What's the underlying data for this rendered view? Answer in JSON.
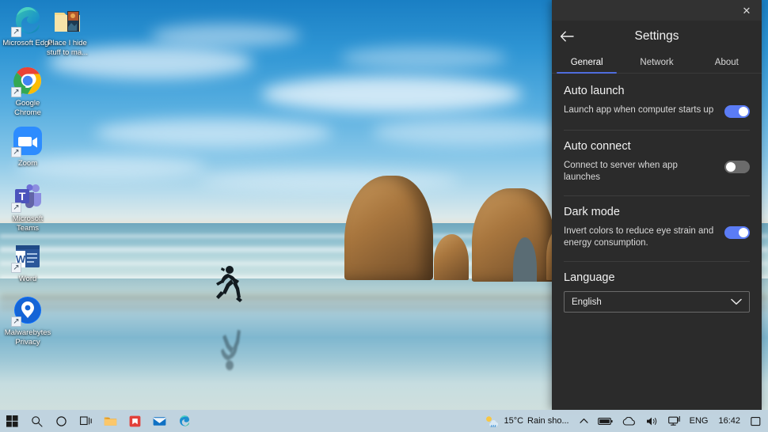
{
  "desktop": {
    "icons": [
      {
        "name": "microsoft-edge",
        "label": "Microsoft Edge",
        "shortcut": true
      },
      {
        "name": "folder-place-i-hide",
        "label": "Place I hide stuff to ma...",
        "shortcut": false
      },
      {
        "name": "google-chrome",
        "label": "Google Chrome",
        "shortcut": true
      },
      {
        "name": "zoom",
        "label": "Zoom",
        "shortcut": true
      },
      {
        "name": "microsoft-teams",
        "label": "Microsoft Teams",
        "shortcut": true
      },
      {
        "name": "word",
        "label": "Word",
        "shortcut": true
      },
      {
        "name": "malwarebytes-privacy",
        "label": "Malwarebytes Privacy",
        "shortcut": true
      }
    ]
  },
  "taskbar": {
    "buttons": [
      {
        "name": "start-button",
        "icon": "windows-logo-icon"
      },
      {
        "name": "search-button",
        "icon": "search-icon"
      },
      {
        "name": "cortana-button",
        "icon": "cortana-circle-icon"
      },
      {
        "name": "task-view-button",
        "icon": "task-view-icon"
      },
      {
        "name": "file-explorer-button",
        "icon": "folder-icon"
      },
      {
        "name": "app-red-button",
        "icon": "red-app-icon"
      },
      {
        "name": "mail-button",
        "icon": "mail-icon"
      },
      {
        "name": "edge-taskbar-button",
        "icon": "edge-icon"
      }
    ],
    "tray": {
      "weather_temp": "15°C",
      "weather_desc": "Rain sho...",
      "weather_icon": "sun-cloud-rain-icon",
      "overflow_icon": "chevron-up-icon",
      "battery_icon": "battery-icon",
      "onedrive_icon": "cloud-icon",
      "volume_icon": "speaker-icon",
      "network_icon": "network-monitor-icon",
      "language": "ENG",
      "clock": "16:42",
      "notifications_icon": "notification-square-icon"
    }
  },
  "settings_panel": {
    "titlebar": {
      "close_label": "✕"
    },
    "header": {
      "title": "Settings",
      "back_icon": "back-arrow-icon"
    },
    "tabs": [
      {
        "label": "General",
        "active": true
      },
      {
        "label": "Network",
        "active": false
      },
      {
        "label": "About",
        "active": false
      }
    ],
    "sections": [
      {
        "id": "auto-launch",
        "title": "Auto launch",
        "row_label": "Launch app when computer starts up",
        "control": "toggle",
        "toggle_state": "on"
      },
      {
        "id": "auto-connect",
        "title": "Auto connect",
        "row_label": "Connect to server when app launches",
        "control": "toggle",
        "toggle_state": "off"
      },
      {
        "id": "dark-mode",
        "title": "Dark mode",
        "row_label": "Invert colors to reduce eye strain and energy consumption.",
        "control": "toggle",
        "toggle_state": "on"
      },
      {
        "id": "language",
        "title": "Language",
        "control": "select",
        "select_value": "English"
      }
    ],
    "colors": {
      "panel_bg": "#2b2b2b",
      "titlebar_bg": "#323232",
      "accent": "#4f6ddd",
      "toggle_on": "#5b7cf5",
      "toggle_off": "#6b6b6b",
      "divider": "#3d3d3d"
    }
  }
}
